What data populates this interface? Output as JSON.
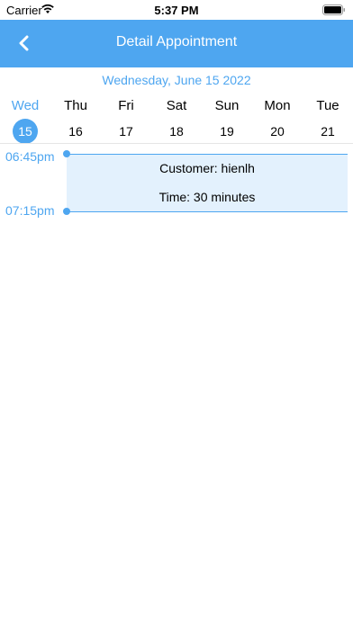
{
  "status_bar": {
    "carrier": "Carrier",
    "time": "5:37 PM",
    "icons": [
      "wifi-icon",
      "battery-icon"
    ]
  },
  "nav": {
    "title": "Detail Appointment",
    "back_icon": "chevron-left-icon"
  },
  "colors": {
    "accent": "#4ea6f0",
    "card_bg": "#e3f1fd",
    "text": "#000000"
  },
  "date_header": "Wednesday, June 15 2022",
  "week": {
    "days": [
      {
        "name": "Wed",
        "number": "15",
        "selected": true
      },
      {
        "name": "Thu",
        "number": "16",
        "selected": false
      },
      {
        "name": "Fri",
        "number": "17",
        "selected": false
      },
      {
        "name": "Sat",
        "number": "18",
        "selected": false
      },
      {
        "name": "Sun",
        "number": "19",
        "selected": false
      },
      {
        "name": "Mon",
        "number": "20",
        "selected": false
      },
      {
        "name": "Tue",
        "number": "21",
        "selected": false
      }
    ]
  },
  "timeline": {
    "start_label": "06:45pm",
    "end_label": "07:15pm"
  },
  "appointment": {
    "customer": "Customer: hienlh",
    "duration": "Time: 30 minutes"
  }
}
